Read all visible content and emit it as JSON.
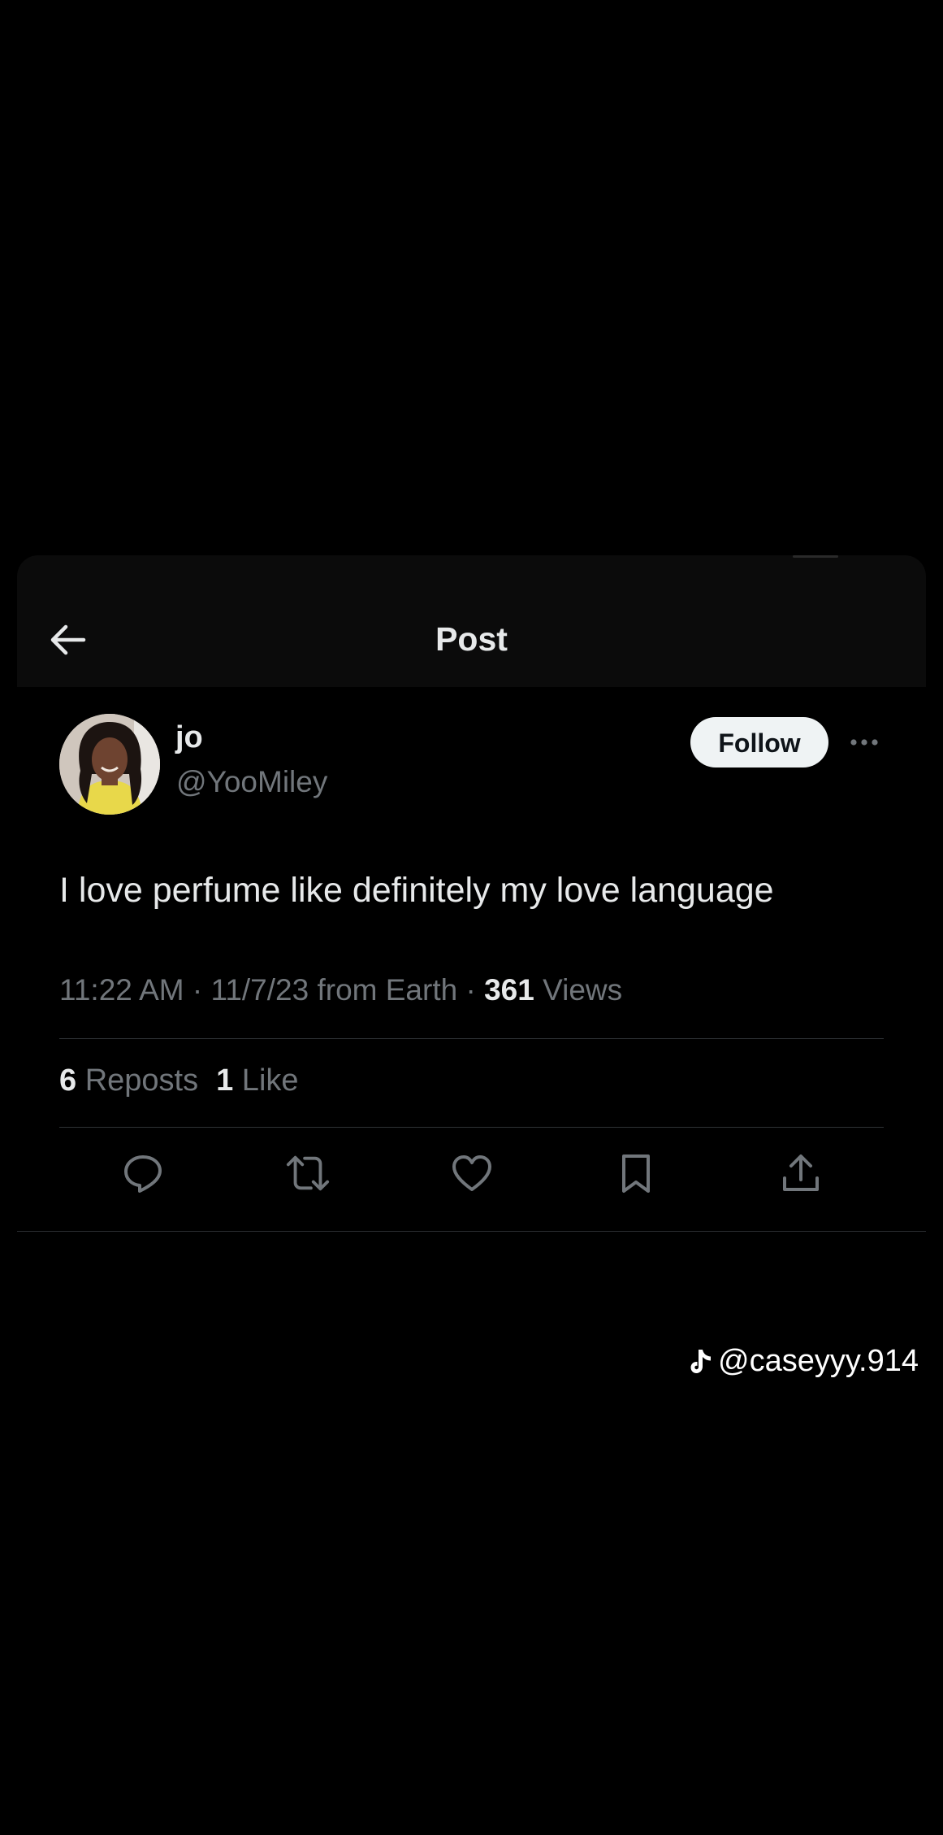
{
  "header": {
    "title": "Post",
    "back_icon": "arrow-left-icon"
  },
  "author": {
    "display_name": "jo",
    "handle": "@YooMiley",
    "follow_label": "Follow",
    "more_icon": "ellipsis-icon"
  },
  "tweet": {
    "text": "I love perfume like definitely my love language"
  },
  "meta": {
    "time": "11:22 AM",
    "sep1": " · ",
    "date": "11/7/23",
    "source": " from Earth",
    "sep2": " · ",
    "views_count": "361",
    "views_label": " Views"
  },
  "stats": {
    "reposts_count": "6",
    "reposts_label": " Reposts",
    "likes_count": "1",
    "likes_label": " Like"
  },
  "actions": [
    {
      "icon": "reply-icon"
    },
    {
      "icon": "repost-icon"
    },
    {
      "icon": "like-icon"
    },
    {
      "icon": "bookmark-icon"
    },
    {
      "icon": "share-icon"
    }
  ],
  "watermark": {
    "logo": "tiktok-icon",
    "handle": "@caseyyy.914"
  },
  "colors": {
    "background": "#000000",
    "header_bg": "#0b0b0b",
    "text_primary": "#e7e9ea",
    "text_secondary": "#71767b",
    "divider": "#2f3336",
    "follow_bg": "#eff3f4"
  }
}
